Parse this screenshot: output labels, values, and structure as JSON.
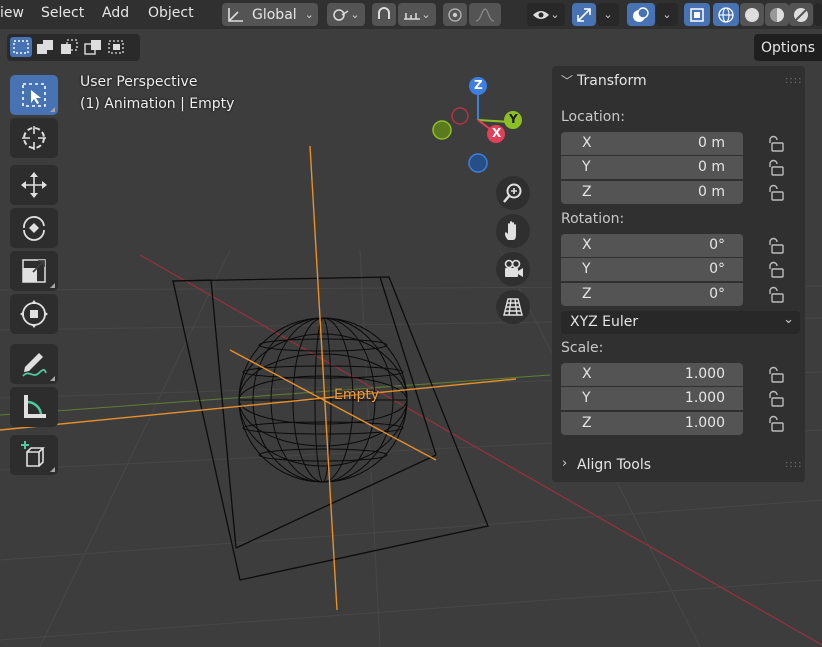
{
  "header": {
    "menus": [
      "iew",
      "Select",
      "Add",
      "Object"
    ],
    "transform_orientation": "Global",
    "options_label": "Options"
  },
  "viewport": {
    "perspective_label": "User Perspective",
    "object_label": "(1) Animation | Empty",
    "empty_name": "Empty",
    "gizmo": {
      "z": "Z",
      "y": "Y",
      "x": "X"
    }
  },
  "toolbar": {
    "tools": [
      "select-box",
      "cursor",
      "move",
      "rotate",
      "scale",
      "transform",
      "annotate",
      "measure",
      "add-cube"
    ]
  },
  "sidebar": {
    "transform": {
      "title": "Transform",
      "location_label": "Location:",
      "location": [
        {
          "axis": "X",
          "value": "0 m"
        },
        {
          "axis": "Y",
          "value": "0 m"
        },
        {
          "axis": "Z",
          "value": "0 m"
        }
      ],
      "rotation_label": "Rotation:",
      "rotation": [
        {
          "axis": "X",
          "value": "0°"
        },
        {
          "axis": "Y",
          "value": "0°"
        },
        {
          "axis": "Z",
          "value": "0°"
        }
      ],
      "rotation_mode": "XYZ Euler",
      "scale_label": "Scale:",
      "scale": [
        {
          "axis": "X",
          "value": "1.000"
        },
        {
          "axis": "Y",
          "value": "1.000"
        },
        {
          "axis": "Z",
          "value": "1.000"
        }
      ]
    },
    "align_tools": {
      "title": "Align Tools"
    }
  },
  "colors": {
    "accent": "#4772b3",
    "empty_orange": "#f0a048",
    "x_axis": "#e0405a",
    "y_axis": "#8cbf26",
    "z_axis": "#3d7fe0"
  }
}
